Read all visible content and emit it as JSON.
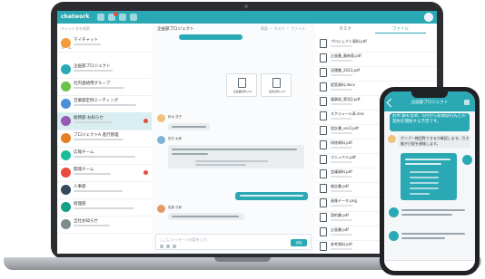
{
  "colors": {
    "accent": "#2aa9b5",
    "badge": "#e74c3c",
    "laptop_frame": "#2b2d31"
  },
  "app": {
    "logo": "chatwork",
    "user_avatar": "user-avatar-icon"
  },
  "sidebar": {
    "search_placeholder": "チャット名を検索",
    "section_label": "ルーム",
    "rooms": [
      {
        "name": "マイチャット",
        "color": "#f39c3c"
      },
      {
        "name": "企画部プロジェクト",
        "color": "#2aa9b5"
      },
      {
        "name": "社内連絡用グループ",
        "color": "#6cc24a"
      },
      {
        "name": "営業部定例ミーティング",
        "color": "#4a90d9"
      },
      {
        "name": "総務部 お知らせ",
        "color": "#9b59b6",
        "badge": true
      },
      {
        "name": "プロジェクトA 進行管理",
        "color": "#e67e22"
      },
      {
        "name": "広報チーム",
        "color": "#1abc9c"
      },
      {
        "name": "開発チーム",
        "color": "#e74c3c",
        "badge": true
      },
      {
        "name": "人事部",
        "color": "#34495e"
      },
      {
        "name": "経理部",
        "color": "#16a085"
      },
      {
        "name": "全社お知らせ",
        "color": "#7f8c8d"
      }
    ]
  },
  "chat": {
    "title": "企画部プロジェクト",
    "header_icons": "概要 ・ タスク ・ ファイル",
    "files": [
      "企画書資料.pdf",
      "提案資料.pdf"
    ],
    "messages": [
      {
        "name": "鈴木 花子"
      },
      {
        "name": "田中 太郎"
      },
      {
        "name": "佐藤 次郎"
      }
    ],
    "input_placeholder": "ここにメッセージ内容を入力",
    "send_label": "送信"
  },
  "files_panel": {
    "tab_task": "タスク",
    "tab_file": "ファイル",
    "files": [
      "プロジェクト資料.pdf",
      "企画書_最新版.pdf",
      "見積書_2023.pdf",
      "提案資料.docx",
      "議事録_第3回.pdf",
      "スケジュール表.xlsx",
      "設計書_ver2.pdf",
      "研修資料.pdf",
      "マニュアル.pdf",
      "会議資料.pdf",
      "報告書.pdf",
      "画像データ.png",
      "契約書.pdf",
      "企画書.pdf",
      "参考資料.pdf"
    ]
  },
  "phone": {
    "title": "企画部プロジェクト",
    "message_top": "鈴木 藤も含め、6月から新規取引先との契約を開始する予定です。",
    "message_mid": "ポンプ一緒回覧できるか確認します。引き継ぎ日程を連絡します。"
  }
}
